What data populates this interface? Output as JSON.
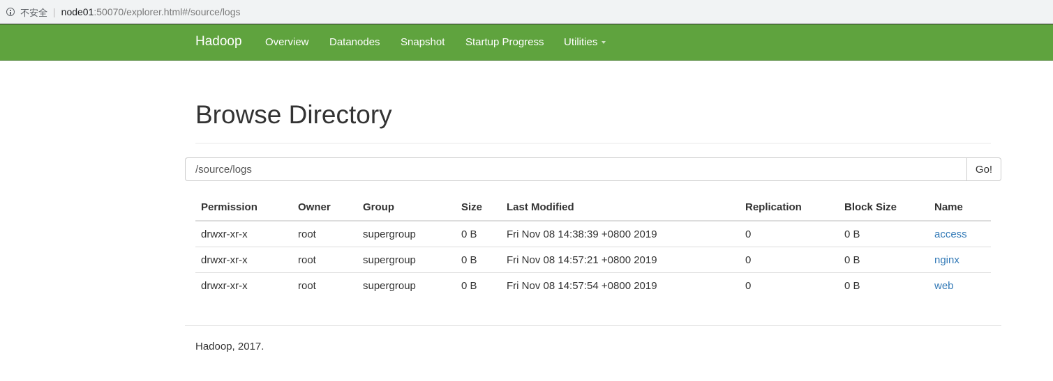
{
  "browser": {
    "insecure_label": "不安全",
    "separator": "|",
    "url_host": "node01",
    "url_rest": ":50070/explorer.html#/source/logs"
  },
  "navbar": {
    "brand": "Hadoop",
    "items": [
      "Overview",
      "Datanodes",
      "Snapshot",
      "Startup Progress",
      "Utilities"
    ]
  },
  "page": {
    "title": "Browse Directory",
    "path_value": "/source/logs",
    "go_label": "Go!"
  },
  "table": {
    "headers": [
      "Permission",
      "Owner",
      "Group",
      "Size",
      "Last Modified",
      "Replication",
      "Block Size",
      "Name"
    ],
    "rows": [
      {
        "permission": "drwxr-xr-x",
        "owner": "root",
        "group": "supergroup",
        "size": "0 B",
        "modified": "Fri Nov 08 14:38:39 +0800 2019",
        "replication": "0",
        "block_size": "0 B",
        "name": "access"
      },
      {
        "permission": "drwxr-xr-x",
        "owner": "root",
        "group": "supergroup",
        "size": "0 B",
        "modified": "Fri Nov 08 14:57:21 +0800 2019",
        "replication": "0",
        "block_size": "0 B",
        "name": "nginx"
      },
      {
        "permission": "drwxr-xr-x",
        "owner": "root",
        "group": "supergroup",
        "size": "0 B",
        "modified": "Fri Nov 08 14:57:54 +0800 2019",
        "replication": "0",
        "block_size": "0 B",
        "name": "web"
      }
    ]
  },
  "footer": {
    "text": "Hadoop, 2017."
  },
  "colors": {
    "navbar_bg": "#5fa33e",
    "link": "#337ab7"
  }
}
